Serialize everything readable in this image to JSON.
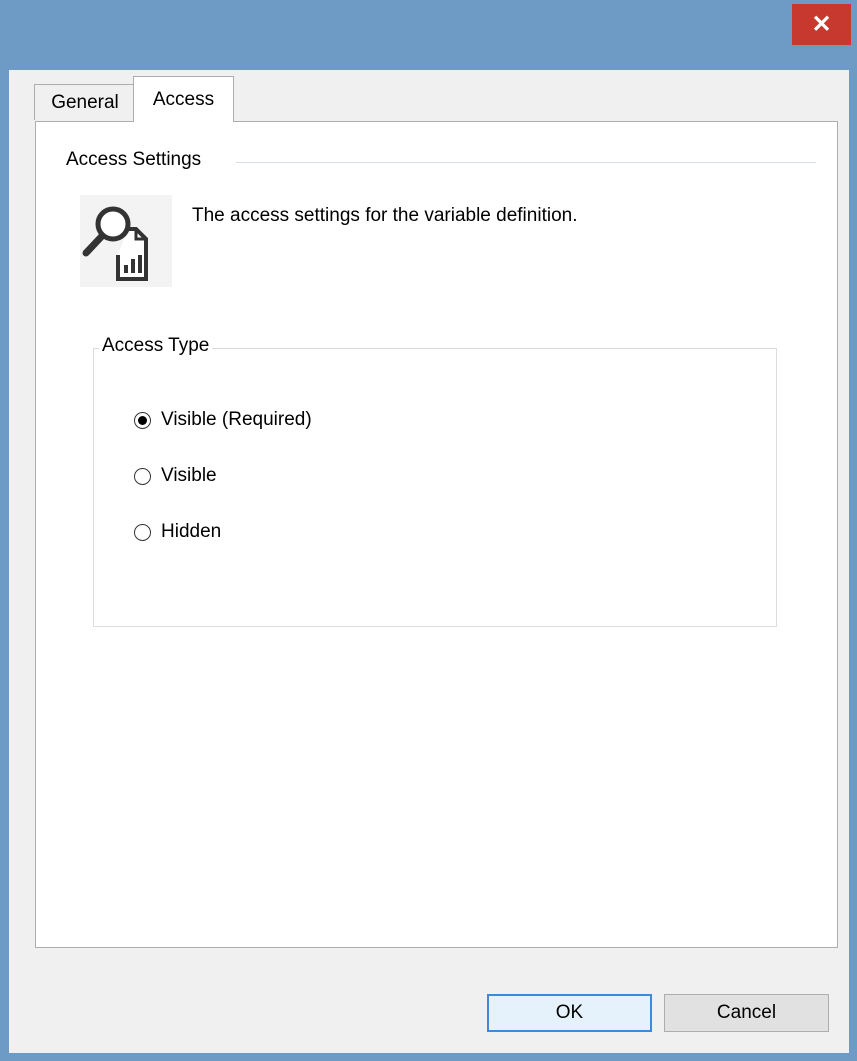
{
  "titlebar": {
    "close_icon": "close-icon",
    "close_glyph": "✕"
  },
  "tabs": [
    {
      "label": "General",
      "selected": false
    },
    {
      "label": "Access",
      "selected": true
    }
  ],
  "section": {
    "title": "Access Settings",
    "description": "The access settings for the variable definition.",
    "icon": "search-report-icon"
  },
  "access_type": {
    "legend": "Access Type",
    "options": [
      {
        "label": "Visible (Required)",
        "checked": true
      },
      {
        "label": "Visible",
        "checked": false
      },
      {
        "label": "Hidden",
        "checked": false
      }
    ]
  },
  "buttons": {
    "ok": "OK",
    "cancel": "Cancel"
  },
  "colors": {
    "title_bar": "#6d9bc5",
    "close_button": "#c7392f",
    "default_button_border": "#3c8ad8"
  }
}
